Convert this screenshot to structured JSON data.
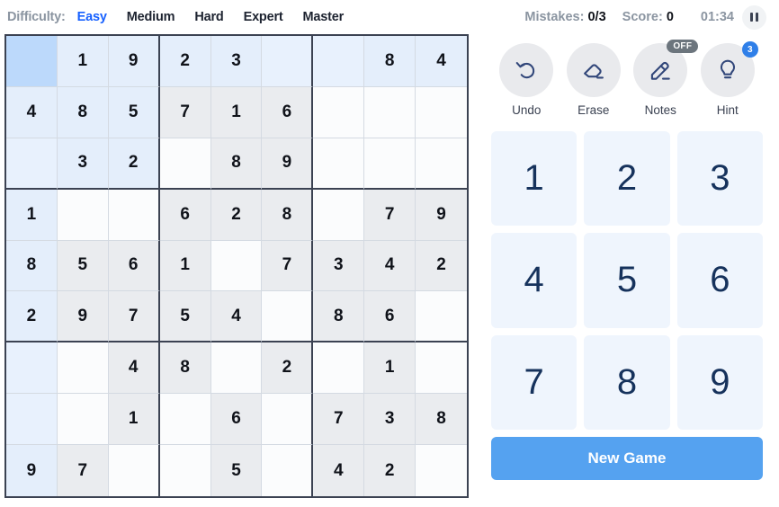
{
  "difficulty": {
    "label": "Difficulty:",
    "options": [
      "Easy",
      "Medium",
      "Hard",
      "Expert",
      "Master"
    ],
    "selected": "Easy",
    "active_color": "#1761ff"
  },
  "status": {
    "mistakes_label": "Mistakes:",
    "mistakes_value": "0/3",
    "score_label": "Score:",
    "score_value": "0",
    "timer": "01:34",
    "pause_icon": "pause-icon"
  },
  "board": {
    "selected_cell": {
      "row": 0,
      "col": 0
    },
    "rows": [
      [
        "",
        "1",
        "9",
        "2",
        "3",
        "",
        "",
        "8",
        "4"
      ],
      [
        "4",
        "8",
        "5",
        "7",
        "1",
        "6",
        "",
        "",
        ""
      ],
      [
        "",
        "3",
        "2",
        "",
        "8",
        "9",
        "",
        "",
        ""
      ],
      [
        "1",
        "",
        "",
        "6",
        "2",
        "8",
        "",
        "7",
        "9"
      ],
      [
        "8",
        "5",
        "6",
        "1",
        "",
        "7",
        "3",
        "4",
        "2"
      ],
      [
        "2",
        "9",
        "7",
        "5",
        "4",
        "",
        "8",
        "6",
        ""
      ],
      [
        "",
        "",
        "4",
        "8",
        "",
        "2",
        "",
        "1",
        ""
      ],
      [
        "",
        "",
        "1",
        "",
        "6",
        "",
        "7",
        "3",
        "8"
      ],
      [
        "9",
        "7",
        "",
        "",
        "5",
        "",
        "4",
        "2",
        ""
      ]
    ]
  },
  "tools": [
    {
      "name": "undo",
      "label": "Undo",
      "icon": "undo-arrow-icon",
      "badge": null
    },
    {
      "name": "erase",
      "label": "Erase",
      "icon": "eraser-icon",
      "badge": null
    },
    {
      "name": "notes",
      "label": "Notes",
      "icon": "pencil-icon",
      "badge": "OFF",
      "badge_type": "off"
    },
    {
      "name": "hint",
      "label": "Hint",
      "icon": "lightbulb-icon",
      "badge": "3",
      "badge_type": "count"
    }
  ],
  "numpad": [
    "1",
    "2",
    "3",
    "4",
    "5",
    "6",
    "7",
    "8",
    "9"
  ],
  "new_game": {
    "label": "New Game",
    "color": "#55a2f0"
  }
}
